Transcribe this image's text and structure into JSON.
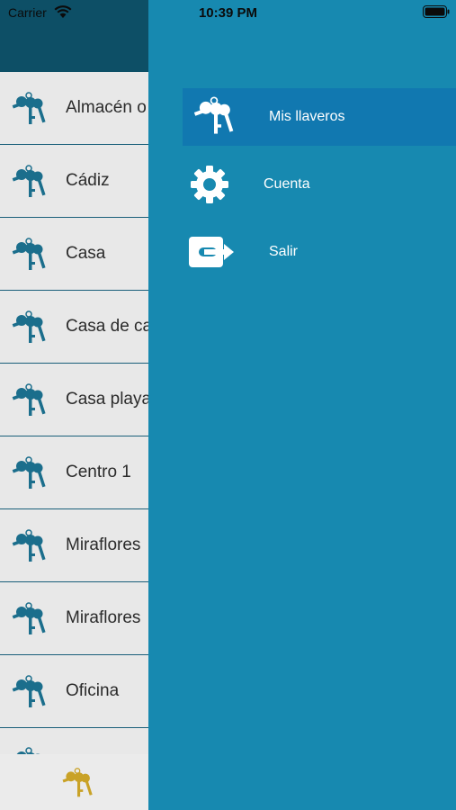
{
  "status_bar": {
    "carrier": "Carrier",
    "time": "10:39 PM"
  },
  "background_list": {
    "items": [
      {
        "label": "Almacén o"
      },
      {
        "label": "Cádiz"
      },
      {
        "label": "Casa"
      },
      {
        "label": "Casa de ca"
      },
      {
        "label": "Casa playa"
      },
      {
        "label": "Centro 1"
      },
      {
        "label": "Miraflores"
      },
      {
        "label": "Miraflores"
      },
      {
        "label": "Oficina"
      }
    ]
  },
  "drawer": {
    "items": [
      {
        "label": "Mis llaveros",
        "icon": "keys-icon",
        "active": true
      },
      {
        "label": "Cuenta",
        "icon": "gear-icon",
        "active": false
      },
      {
        "label": "Salir",
        "icon": "logout-icon",
        "active": false
      }
    ]
  },
  "colors": {
    "drawer_bg": "#1789b0",
    "active_item_bg": "#1178b0",
    "key_icon": "#1b6e8c",
    "tab_key_icon": "#c9a227"
  }
}
